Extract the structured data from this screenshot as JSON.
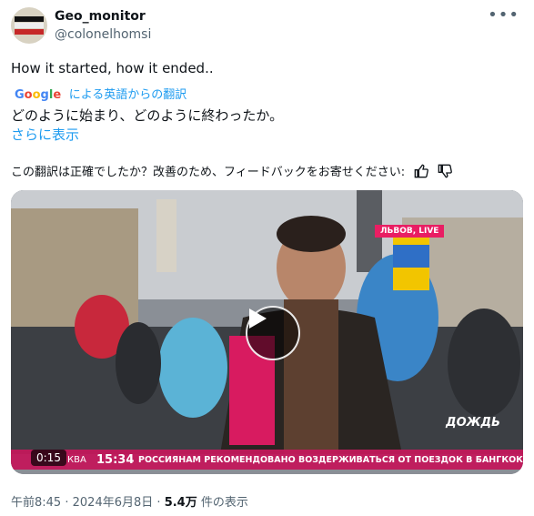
{
  "author": {
    "display_name": "Geo_monitor",
    "handle": "@colonelhomsi"
  },
  "tweet": {
    "text": "How it started, how it ended..",
    "translated_by_suffix": "による英語からの翻訳",
    "translated_text": "どのように始まり、どのように終わったか。",
    "show_more": "さらに表示",
    "feedback_prompt": "この翻訳は正確でしたか？改善のため、フィードバックをお寄せください:"
  },
  "google_logo": [
    "G",
    "o",
    "o",
    "g",
    "l",
    "e"
  ],
  "video": {
    "duration": "0:15",
    "location_badge": "ЛЬВОВ, LIVE",
    "ticker_prefix": "КВА",
    "ticker_time": "15:34",
    "ticker_text": "РОССИЯНАМ РЕКОМЕНДОВАНО ВОЗДЕРЖИВАТЬСЯ ОТ ПОЕЗДОК В БАНГКОК ИЗ-ЗА АКЦИЙ ПРОТЕСТА",
    "channel_logo": "ДОЖДЬ"
  },
  "meta": {
    "time": "午前8:45",
    "date": "2024年6月8日",
    "views_count": "5.4万",
    "views_suffix": "件の表示"
  },
  "icons": {
    "more": "more-icon",
    "thumbs_up": "thumbs-up-icon",
    "thumbs_down": "thumbs-down-icon",
    "play": "play-icon"
  },
  "colors": {
    "link": "#1d9bf0",
    "ticker": "#c2185b",
    "secondary_text": "#536471"
  }
}
